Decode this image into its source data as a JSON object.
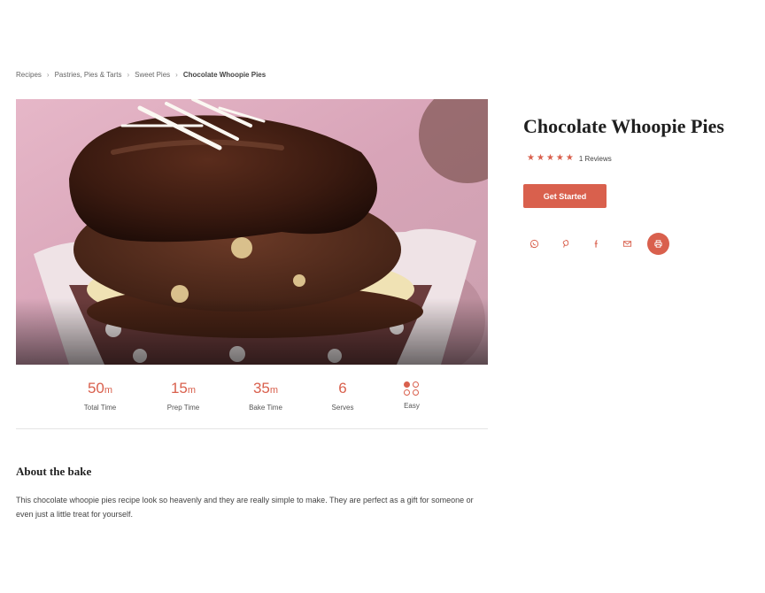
{
  "breadcrumb": {
    "items": [
      "Recipes",
      "Pastries, Pies & Tarts",
      "Sweet Pies"
    ],
    "current": "Chocolate Whoopie Pies"
  },
  "recipe": {
    "title": "Chocolate Whoopie Pies",
    "rating_stars": 5,
    "reviews": "1 Reviews",
    "cta_label": "Get Started"
  },
  "stats": [
    {
      "value": "50",
      "unit": "m",
      "label": "Total Time"
    },
    {
      "value": "15",
      "unit": "m",
      "label": "Prep Time"
    },
    {
      "value": "35",
      "unit": "m",
      "label": "Bake Time"
    },
    {
      "value": "6",
      "unit": "",
      "label": "Serves"
    },
    {
      "value": "",
      "unit": "",
      "label": "Easy"
    }
  ],
  "about": {
    "title": "About the bake",
    "text": "This chocolate whoopie pies recipe look so heavenly and they are really simple to make. They are perfect as a gift for someone or even just a little treat for yourself."
  },
  "share_icons": [
    "whatsapp-icon",
    "pinterest-icon",
    "facebook-icon",
    "email-icon",
    "print-icon"
  ],
  "colors": {
    "accent": "#d9604d"
  }
}
